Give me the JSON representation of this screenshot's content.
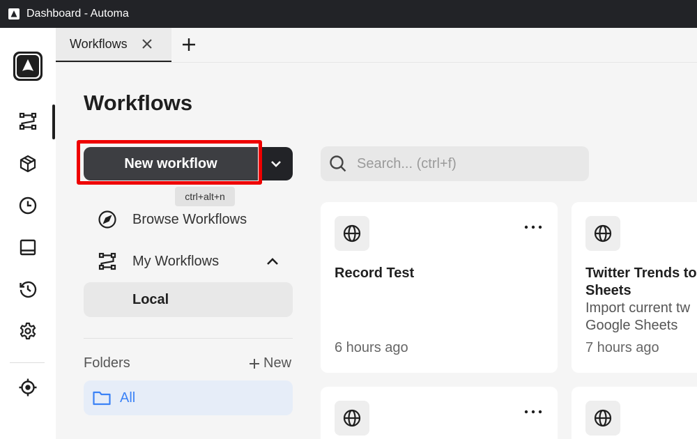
{
  "window": {
    "title": "Dashboard - Automa"
  },
  "sidebar": {
    "items": [
      {
        "name": "workflows",
        "icon": "workflow-icon",
        "active": true
      },
      {
        "name": "packages",
        "icon": "cube-icon"
      },
      {
        "name": "schedule",
        "icon": "clock-icon"
      },
      {
        "name": "storage",
        "icon": "storage-icon"
      },
      {
        "name": "logs",
        "icon": "history-icon"
      },
      {
        "name": "settings",
        "icon": "gear-icon"
      },
      {
        "name": "picker",
        "icon": "crosshair-icon"
      }
    ]
  },
  "tabs": [
    {
      "label": "Workflows",
      "active": true
    }
  ],
  "page": {
    "title": "Workflows"
  },
  "actions": {
    "new_workflow": "New workflow",
    "shortcut": "ctrl+alt+n"
  },
  "nav": {
    "browse": "Browse Workflows",
    "my_workflows": "My Workflows",
    "local": "Local"
  },
  "folders": {
    "label": "Folders",
    "new": "New",
    "all": "All"
  },
  "search": {
    "placeholder": "Search... (ctrl+f)"
  },
  "cards": [
    {
      "title": "Record Test",
      "description": "",
      "time": "6 hours ago"
    },
    {
      "title": "Twitter Trends to Sheets",
      "description": "Import current tw Google Sheets",
      "time": "7 hours ago"
    },
    {
      "title": "",
      "description": "",
      "time": ""
    },
    {
      "title": "",
      "description": "",
      "time": ""
    }
  ],
  "colors": {
    "highlight": "#ee0000",
    "accent": "#3b82f6",
    "titlebar": "#222327"
  }
}
